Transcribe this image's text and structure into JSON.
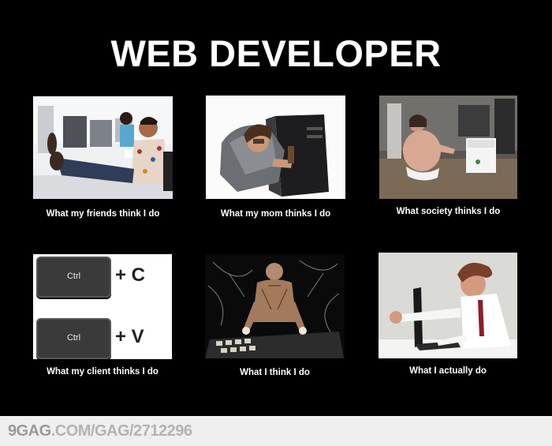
{
  "title": "WEB DEVELOPER",
  "panels": [
    {
      "caption": "What my friends think I do"
    },
    {
      "caption": "What my mom thinks I do"
    },
    {
      "caption": "What society thinks I do"
    },
    {
      "caption": "What my client thinks I do",
      "keys": [
        {
          "key": "Ctrl",
          "op": "+ C"
        },
        {
          "key": "Ctrl",
          "op": "+ V"
        }
      ]
    },
    {
      "caption": "What I think I do"
    },
    {
      "caption": "What I actually do"
    }
  ],
  "footer": {
    "brand": "9GAG",
    "url": ".COM/GAG/2712296"
  }
}
